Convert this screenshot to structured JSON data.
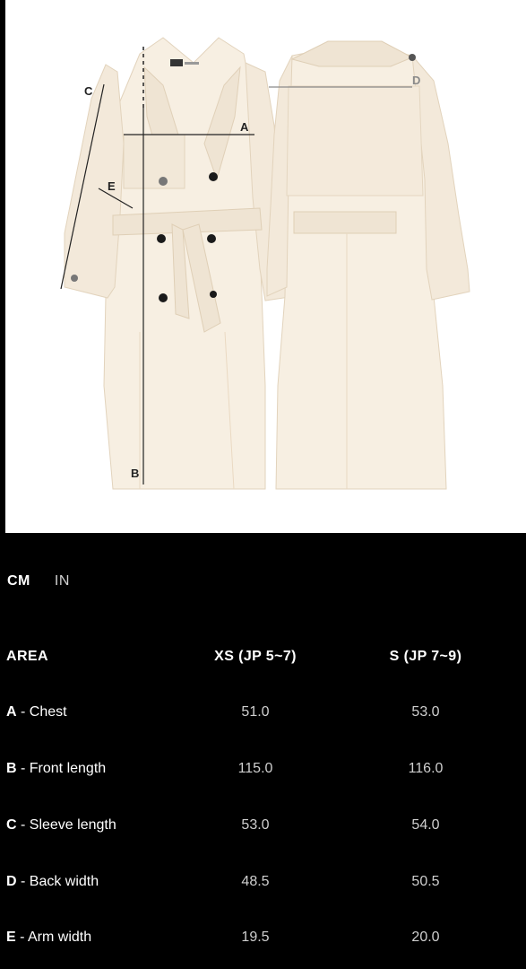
{
  "figure": {
    "labels": {
      "a": "A",
      "b": "B",
      "c": "C",
      "d": "D",
      "e": "E"
    }
  },
  "units": {
    "cm": "CM",
    "in": "IN"
  },
  "table": {
    "headers": [
      "AREA",
      "XS (JP 5~7)",
      "S (JP 7~9)"
    ],
    "rows": [
      {
        "letter": "A",
        "name": " - Chest",
        "xs": "51.0",
        "s": "53.0"
      },
      {
        "letter": "B",
        "name": " - Front length",
        "xs": "115.0",
        "s": "116.0"
      },
      {
        "letter": "C",
        "name": " - Sleeve length",
        "xs": "53.0",
        "s": "54.0"
      },
      {
        "letter": "D",
        "name": " - Back width",
        "xs": "48.5",
        "s": "50.5"
      },
      {
        "letter": "E",
        "name": " - Arm width",
        "xs": "19.5",
        "s": "20.0"
      }
    ]
  },
  "colors": {
    "background": "#000000",
    "coat": "#f7efe2",
    "coat_shadow": "#e9dcc8",
    "button": "#1a1a1a",
    "measure_line": "#222222",
    "measure_d": "#8a8a8a"
  }
}
